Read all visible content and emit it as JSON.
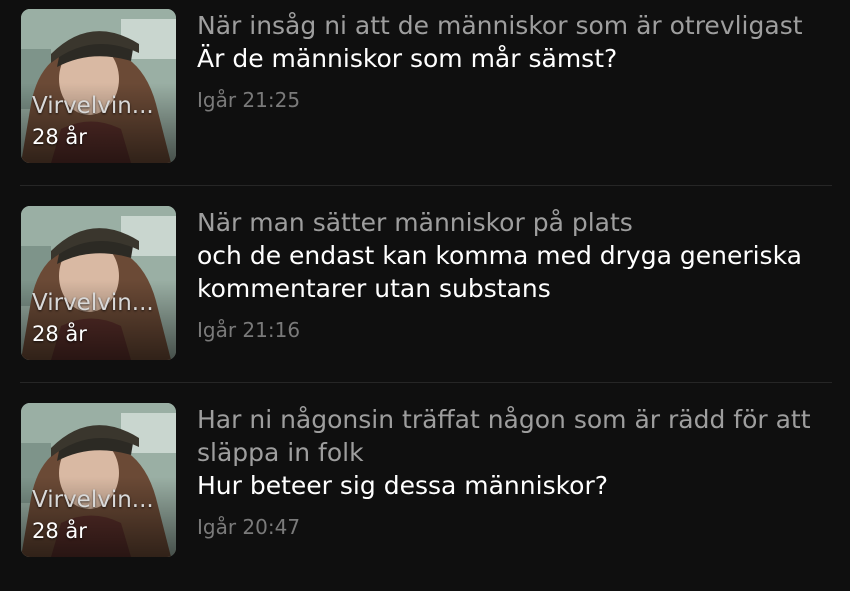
{
  "posts": [
    {
      "title": "När insåg ni att de människor som är otrevligast",
      "body": "Är de människor som mår sämst?",
      "time": "Igår 21:25",
      "author": {
        "name": "Virvelvin...",
        "age": "28 år"
      }
    },
    {
      "title": "När man sätter människor på plats",
      "body": "och de endast kan komma med dryga generiska kommentarer utan substans",
      "time": "Igår 21:16",
      "author": {
        "name": "Virvelvin...",
        "age": "28 år"
      }
    },
    {
      "title": "Har ni någonsin träffat någon som är rädd för att släppa in folk",
      "body": "Hur beteer sig dessa människor?",
      "time": "Igår 20:47",
      "author": {
        "name": "Virvelvin...",
        "age": "28 år"
      }
    }
  ],
  "colors": {
    "background": "#0f0f0f",
    "title": "#9e9e9e",
    "body": "#ffffff",
    "time": "#7a7a7a",
    "divider": "#262626"
  }
}
